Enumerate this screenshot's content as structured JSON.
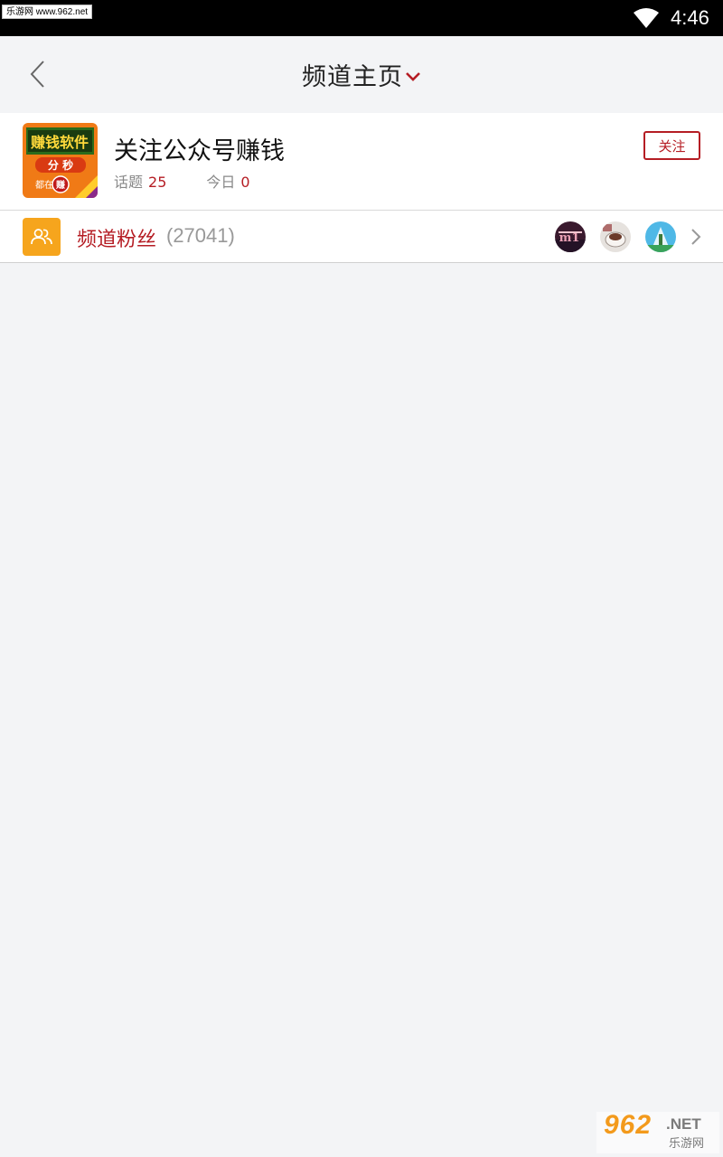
{
  "status_bar": {
    "watermark": "乐游网 www.962.net",
    "time": "4:46"
  },
  "header": {
    "title": "频道主页",
    "back_icon": "chevron-left-icon",
    "dropdown_icon": "chevron-down-icon"
  },
  "channel": {
    "name": "关注公众号赚钱",
    "logo_icon": "channel-logo",
    "topics_label": "话题",
    "topics_count": "25",
    "today_label": "今日",
    "today_count": "0",
    "follow_label": "关注"
  },
  "fans": {
    "label": "频道粉丝",
    "count": "(27041)",
    "icon": "users-icon",
    "avatars": [
      "avatar-1",
      "avatar-2",
      "avatar-3"
    ]
  },
  "watermark_bottom": {
    "number": "962",
    "net": ".NET",
    "chinese": "乐游网"
  },
  "colors": {
    "accent": "#b51d24",
    "fans_icon_bg": "#f6a51d",
    "page_bg": "#f3f4f6",
    "status_bar": "#000000"
  }
}
